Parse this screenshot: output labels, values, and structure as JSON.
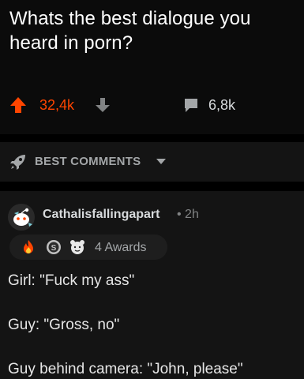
{
  "post": {
    "title": "Whats the best dialogue you heard in porn?",
    "votes": "32,4k",
    "comments": "6,8k"
  },
  "sort": {
    "label": "BEST COMMENTS"
  },
  "comment": {
    "author": "Cathalisfallingapart",
    "time": "• 2h",
    "awards_label": "4 Awards",
    "lines": [
      "Girl: \"Fuck my ass\"",
      "Guy: \"Gross, no\"",
      "Guy behind camera: \"John, please\""
    ]
  },
  "colors": {
    "upvote": "#ff4500",
    "background": "#000000",
    "panel": "#141414",
    "text": "#d7dadc",
    "muted": "#818384"
  },
  "icons": {
    "upvote": "arrow-up-icon",
    "downvote": "arrow-down-icon",
    "comments": "speech-bubble-icon",
    "sort": "rocket-icon",
    "caret": "caret-down-icon",
    "avatar": "snoo-avatar-icon",
    "awards": [
      "fire-award-icon",
      "silver-coin-icon",
      "wholesome-award-icon"
    ]
  }
}
